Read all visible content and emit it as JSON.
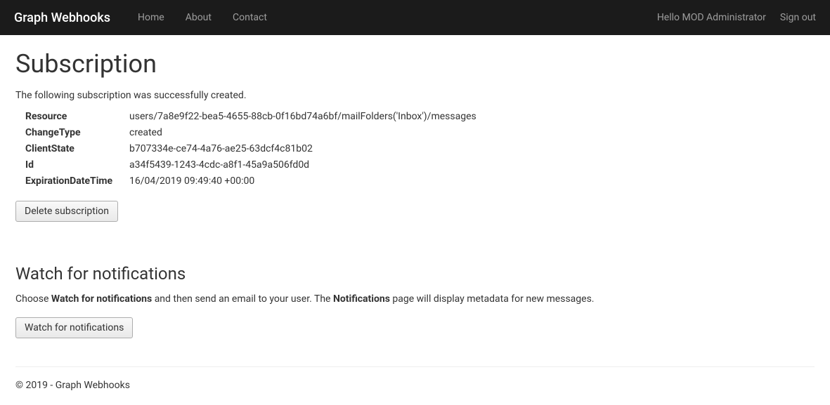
{
  "navbar": {
    "brand": "Graph Webhooks",
    "links": {
      "home": "Home",
      "about": "About",
      "contact": "Contact"
    },
    "greeting": "Hello MOD Administrator",
    "signout": "Sign out"
  },
  "page": {
    "title": "Subscription",
    "success_message": "The following subscription was successfully created."
  },
  "subscription": {
    "labels": {
      "resource": "Resource",
      "changeType": "ChangeType",
      "clientState": "ClientState",
      "id": "Id",
      "expiration": "ExpirationDateTime"
    },
    "values": {
      "resource": "users/7a8e9f22-bea5-4655-88cb-0f16bd74a6bf/mailFolders('Inbox')/messages",
      "changeType": "created",
      "clientState": "b707334e-ce74-4a76-ae25-63dcf4c81b02",
      "id": "a34f5439-1243-4cdc-a8f1-45a9a506fd0d",
      "expiration": "16/04/2019 09:49:40 +00:00"
    }
  },
  "buttons": {
    "delete": "Delete subscription",
    "watch": "Watch for notifications"
  },
  "watch": {
    "heading": "Watch for notifications",
    "instruction_prefix": "Choose ",
    "instruction_bold1": "Watch for notifications",
    "instruction_mid": " and then send an email to your user. The ",
    "instruction_bold2": "Notifications",
    "instruction_suffix": " page will display metadata for new messages."
  },
  "footer": "© 2019 - Graph Webhooks"
}
